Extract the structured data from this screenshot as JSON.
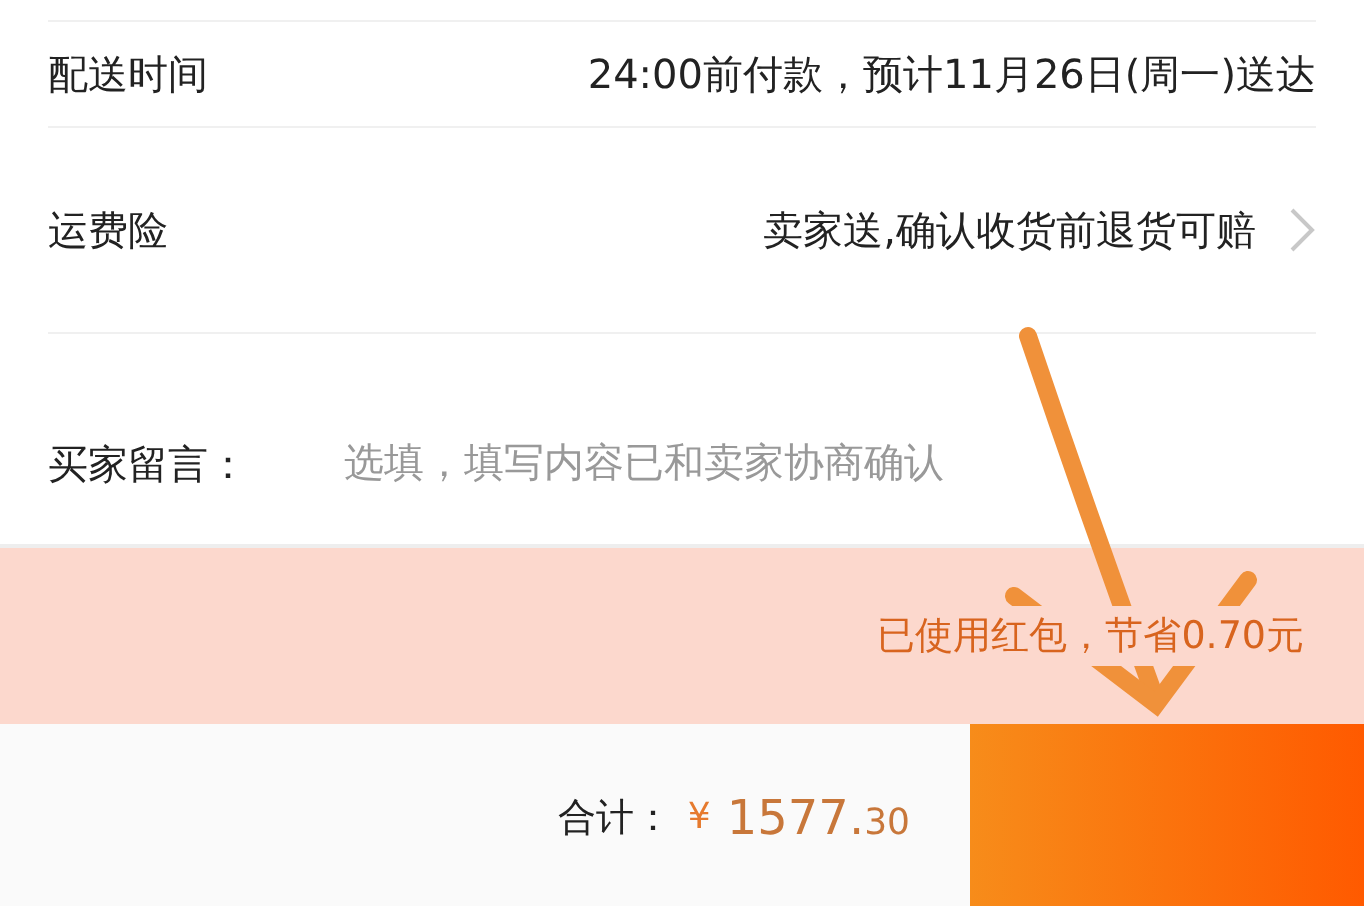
{
  "rows": [
    {
      "label": "配送时间",
      "value": "24:00前付款，预计11月26日(周一)送达",
      "chevron": false,
      "kind": "info"
    },
    {
      "label": "运费险",
      "value": "卖家送,确认收货前退货可赔",
      "chevron": true,
      "kind": "info"
    },
    {
      "label": "买家留言：",
      "placeholder": "选填，填写内容已和卖家协商确认",
      "chevron": false,
      "kind": "input"
    }
  ],
  "red_packet_note": "已使用红包，节省0.70元",
  "footer": {
    "total_label": "合计：",
    "currency": "¥",
    "amount_main": "1577.",
    "amount_decimal": "30"
  }
}
